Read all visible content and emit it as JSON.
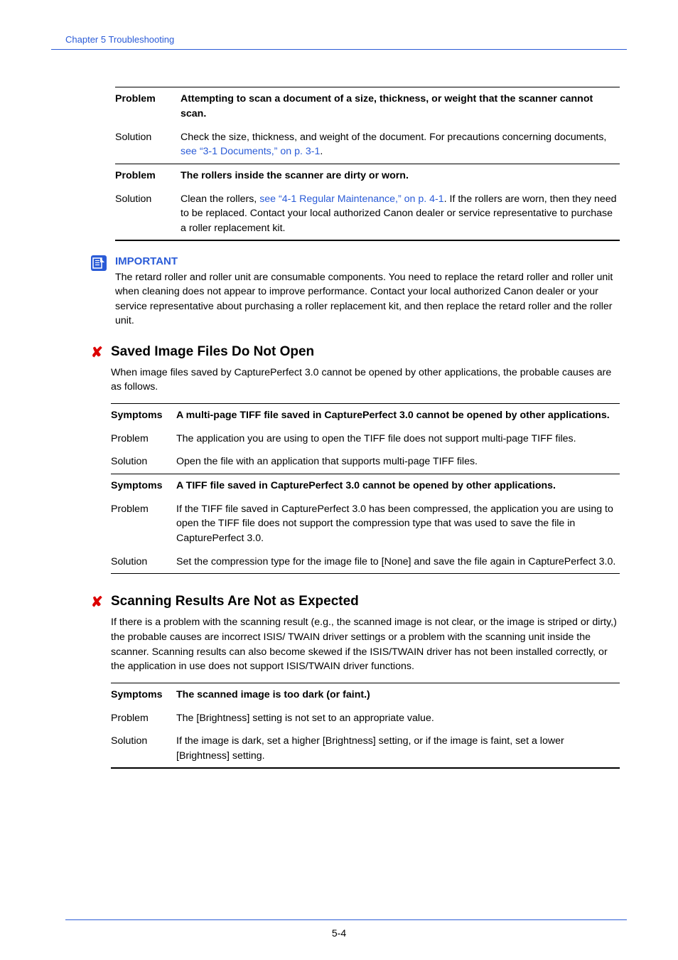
{
  "chapter_header": "Chapter 5   Troubleshooting",
  "block1": {
    "problem_label": "Problem",
    "problem1_text": "Attempting to scan a document of a size, thickness, or weight that the scanner cannot scan.",
    "solution_label": "Solution",
    "solution1_lead": "Check the size, thickness, and weight of the document. For precautions concerning documents, ",
    "solution1_link": "see “3-1 Documents,” on p. 3-1",
    "solution1_tail": ".",
    "problem2_text": "The rollers inside the scanner are dirty or worn.",
    "solution2_lead": "Clean the rollers, ",
    "solution2_link": "see “4-1 Regular Maintenance,” on p. 4-1",
    "solution2_tail": ". If the rollers are worn, then they need to be replaced. Contact your local authorized Canon dealer or service representative to purchase a roller replacement kit."
  },
  "important": {
    "title": "IMPORTANT",
    "text": "The retard roller and roller unit are consumable components. You need to replace the retard roller and roller unit when cleaning does not appear to improve performance. Contact your local authorized Canon dealer or your service representative about purchasing a roller replacement kit, and then replace the retard roller and the roller unit."
  },
  "sect_saved": {
    "title": "Saved Image Files Do Not Open",
    "intro": "When image files saved by CapturePerfect 3.0 cannot be opened by other applications, the probable causes are as follows.",
    "symptoms_label": "Symptoms",
    "problem_label": "Problem",
    "solution_label": "Solution",
    "sym1": "A multi-page TIFF file saved in CapturePerfect 3.0 cannot be opened by other applications.",
    "prob1": "The application you are using to open the TIFF file does not support multi-page TIFF files.",
    "sol1": "Open the file with an application that supports multi-page TIFF files.",
    "sym2": "A TIFF file saved in CapturePerfect 3.0 cannot be opened by other applications.",
    "prob2": "If the TIFF file saved in CapturePerfect 3.0 has been compressed, the application you are using to open the TIFF file does not support the compression type that was used to save the file in CapturePerfect 3.0.",
    "sol2": "Set the compression type for the image file to [None] and save the file again in CapturePerfect 3.0."
  },
  "sect_scan": {
    "title": "Scanning Results Are Not as Expected",
    "intro": "If there is a problem with the scanning result (e.g., the scanned image is not clear, or the image is striped or dirty,) the probable causes are incorrect ISIS/ TWAIN driver settings or a problem with the scanning unit inside the scanner. Scanning results can also become skewed if the ISIS/TWAIN driver has not been installed correctly, or the application in use does not support ISIS/TWAIN driver functions.",
    "symptoms_label": "Symptoms",
    "problem_label": "Problem",
    "solution_label": "Solution",
    "sym1": "The scanned image is too dark (or faint.)",
    "prob1": "The [Brightness] setting is not set to an appropriate value.",
    "sol1": "If the image is dark, set a higher [Brightness] setting, or if the image is faint, set a lower [Brightness] setting."
  },
  "page_number": "5-4"
}
